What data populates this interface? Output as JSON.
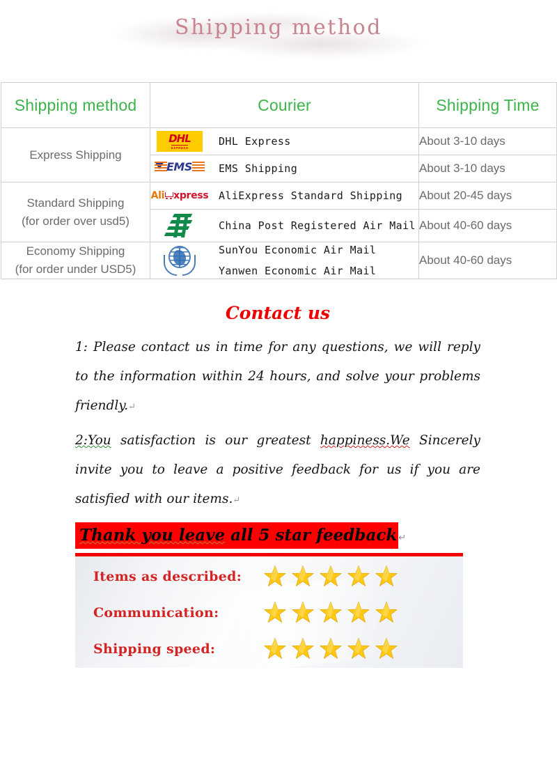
{
  "page": {
    "title": "Shipping method"
  },
  "table": {
    "headers": [
      "Shipping method",
      "Courier",
      "Shipping Time"
    ],
    "rows": [
      {
        "method": "Express Shipping",
        "method_note": "",
        "couriers": [
          {
            "logo": "dhl-logo",
            "name": "DHL Express"
          }
        ],
        "time": "About 3-10 days"
      },
      {
        "method": "",
        "method_note": "",
        "couriers": [
          {
            "logo": "ems-logo",
            "name": "EMS Shipping"
          }
        ],
        "time": "About 3-10 days"
      },
      {
        "method": "Standard Shipping",
        "method_note": "(for order over usd5)",
        "couriers": [
          {
            "logo": "aliexpress-logo",
            "name": "AliExpress Standard Shipping"
          }
        ],
        "time": "About 20-45 days"
      },
      {
        "method": "",
        "method_note": "",
        "couriers": [
          {
            "logo": "china-post-logo",
            "name": "China Post Registered Air Mail"
          }
        ],
        "time": "About 40-60 days"
      },
      {
        "method": "Economy Shipping",
        "method_note": "(for order under USD5)",
        "couriers": [
          {
            "logo": "un-globe-logo",
            "name": "SunYou Economic Air Mail"
          },
          {
            "logo": "",
            "name": "Yanwen Economic Air Mail"
          }
        ],
        "time": "About 40-60 days"
      }
    ]
  },
  "contact": {
    "heading": "Contact us",
    "line1": "1: Please contact us in time for any questions, we will reply to the information within 24 hours, and solve your problems friendly.",
    "line1_pilcrow": "↵",
    "line2_a": "2:You",
    "line2_b": " satisfaction is our greatest ",
    "line2_c": "happiness.We",
    "line2_d": " Sincerely invite you to leave a positive feedback for us if you are satisfied with our items.",
    "line2_pilcrow": "↵"
  },
  "banner": {
    "text_a": "Thank you leave",
    "text_b": " all 5 star feedback",
    "pilcrow": "↵",
    "background": "#fe0000",
    "text_color": "#0a0a0a"
  },
  "rating": {
    "rows": [
      {
        "label": "Items as described:",
        "stars": 5
      },
      {
        "label": "Communication:",
        "stars": 5
      },
      {
        "label": "Shipping speed:",
        "stars": 5
      }
    ],
    "star_count": 5,
    "star_color": "#ffc815",
    "label_color": "#d42323",
    "rule_color": "#f20000"
  },
  "colors": {
    "header_green": "#3cb44a",
    "title_rose": "#c8848f",
    "body_gray": "#6b6b6b",
    "contact_red": "#ee0000"
  }
}
